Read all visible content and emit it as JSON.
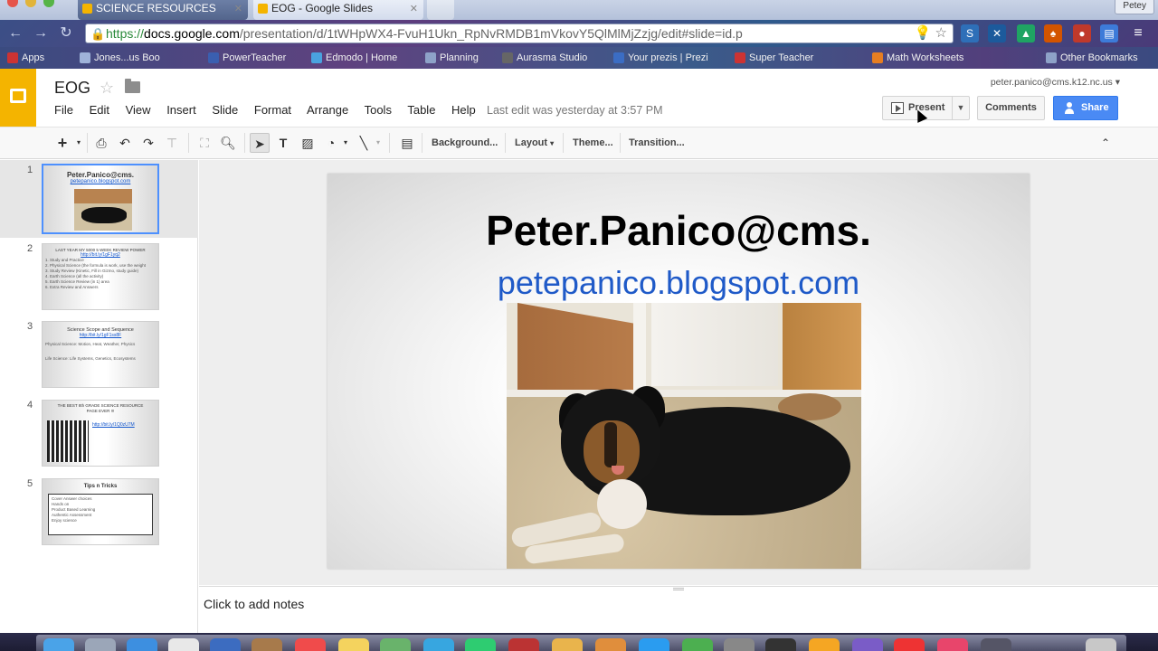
{
  "browser": {
    "tabs": [
      {
        "label": "SCIENCE RESOURCES"
      },
      {
        "label": "EOG - Google Slides"
      }
    ],
    "profile": "Petey",
    "url": {
      "scheme": "https://",
      "host": "docs.google.com",
      "path": "/presentation/d/1tWHpWX4-FvuH1Ukn_RpNvRMDB1mVkovY5QlMlMjZzjg/edit#slide=id.p"
    },
    "bookmarks": [
      {
        "label": "Apps"
      },
      {
        "label": "Jones...us Boo"
      },
      {
        "label": "PowerTeacher"
      },
      {
        "label": "Edmodo | Home"
      },
      {
        "label": "Planning"
      },
      {
        "label": "Aurasma Studio"
      },
      {
        "label": "Your prezis | Prezi"
      },
      {
        "label": "Super Teacher"
      },
      {
        "label": "Math Worksheets"
      },
      {
        "label": "Other Bookmarks"
      }
    ]
  },
  "docs": {
    "title": "EOG",
    "menu": [
      "File",
      "Edit",
      "View",
      "Insert",
      "Slide",
      "Format",
      "Arrange",
      "Tools",
      "Table",
      "Help"
    ],
    "last_edit": "Last edit was yesterday at 3:57 PM",
    "user_email": "peter.panico@cms.k12.nc.us",
    "present_label": "Present",
    "comments_label": "Comments",
    "share_label": "Share"
  },
  "toolbar": {
    "background_label": "Background...",
    "layout_label": "Layout",
    "theme_label": "Theme...",
    "transition_label": "Transition..."
  },
  "filmstrip": [
    {
      "number": "1",
      "title": "Peter.Panico@cms.",
      "link": "petepanico.blogspot.com"
    },
    {
      "number": "2",
      "title": "LAST YEAR MY 5000 5 WEEK REVIEW POWER",
      "link": "http://bit.ly/1gF1yq2",
      "lines": [
        "1. Study and Practice",
        "2. Physical Science (the formula is work, use the weight",
        "3. Study Review (Kinetic, Fill in Gizmo, study guide)",
        "4. Earth Science (all the activity)",
        "5. Earth Science Review (in 1) area",
        "6. Extra Review and Answers"
      ]
    },
    {
      "number": "3",
      "title": "Science Scope and Sequence",
      "link": "http://bit.ly/1gF1ss8F",
      "lines": [
        "Physical Science: Motion, Heat, Weather, Physics",
        "Life Science: Life Systems, Genetics, Ecosystems"
      ]
    },
    {
      "number": "4",
      "title": "THE BEST 8th GRADE SCIENCE RESOURCE PAGE EVER !!!",
      "link": "http://bit.ly/1Q0zU7M"
    },
    {
      "number": "5",
      "title": "Tips n Tricks",
      "lines": [
        "Cover Answer choices",
        "Hands on",
        "Product Based Learning",
        "Authentic Assessment",
        "Enjoy science"
      ]
    }
  ],
  "slide": {
    "title": "Peter.Panico@cms.",
    "link": "petepanico.blogspot.com"
  },
  "notes": {
    "placeholder": "Click to add notes"
  },
  "colors": {
    "slides_brand": "#f4b400",
    "share_blue": "#4a8af4",
    "link_blue": "#1f5ac8"
  }
}
